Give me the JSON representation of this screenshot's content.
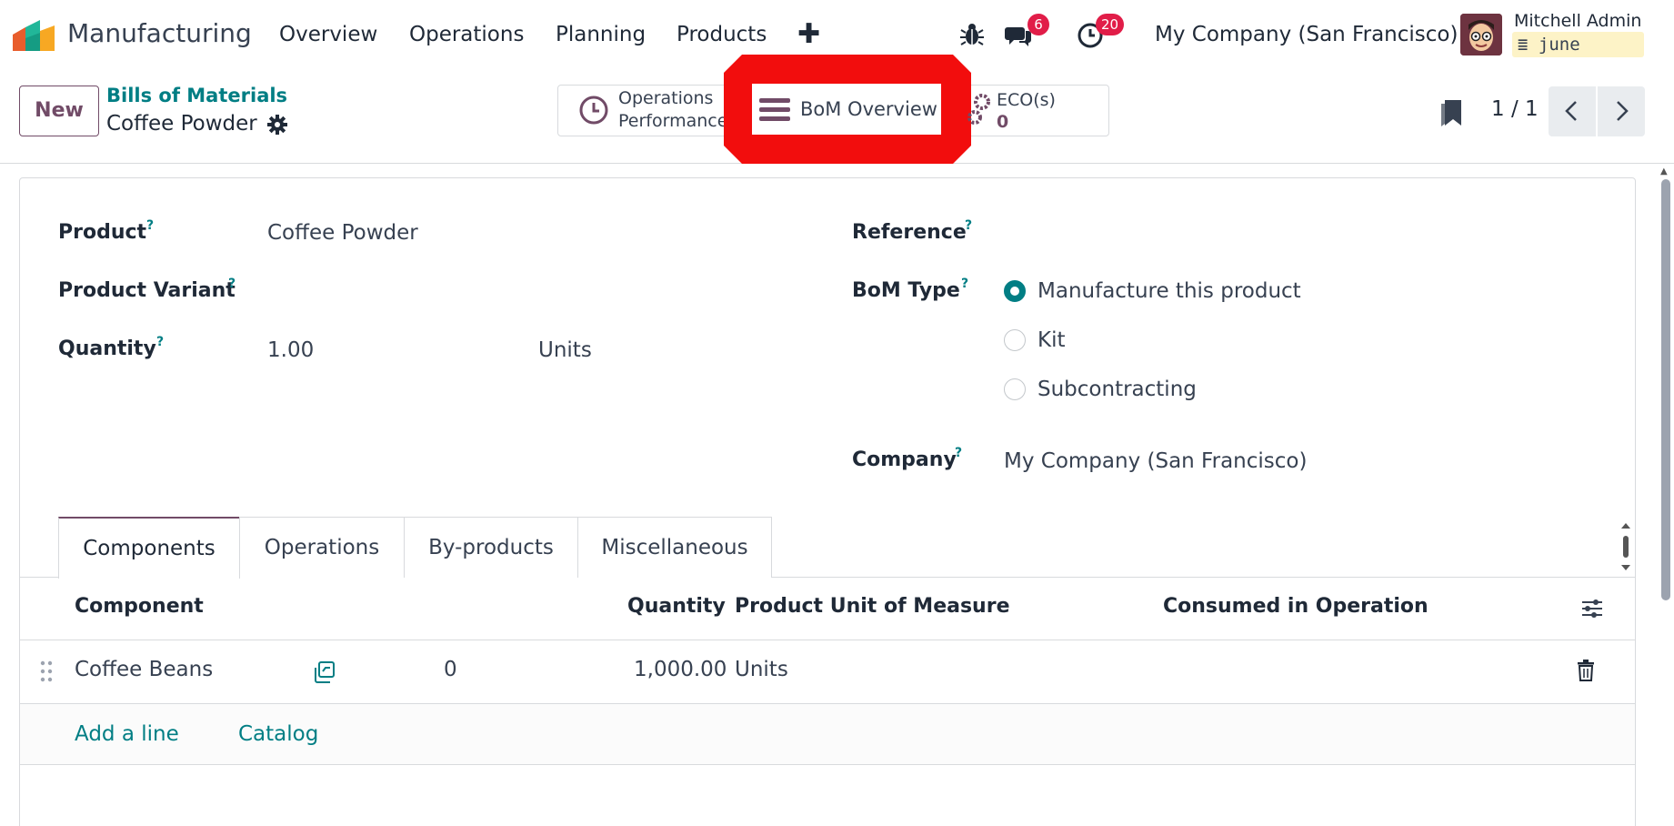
{
  "navbar": {
    "app_name": "Manufacturing",
    "menu": [
      "Overview",
      "Operations",
      "Planning",
      "Products"
    ],
    "plus": "✚",
    "messages_count": "6",
    "activities_count": "20",
    "company": "My Company (San Francisco)",
    "user_name": "Mitchell Admin",
    "db_name": "june",
    "icons": [
      "app-logo",
      "debug-bug-icon",
      "chat-icon",
      "clock-icon",
      "database-icon"
    ]
  },
  "control_panel": {
    "new_label": "New",
    "breadcrumb_parent": "Bills of Materials",
    "breadcrumb_current": "Coffee Powder",
    "smart_buttons": {
      "operations_line1": "Operations",
      "operations_line2": "Performance",
      "bom_overview": "BoM Overview",
      "eco_line1": "ECO(s)",
      "eco_count": "0"
    },
    "pager": "1 / 1",
    "highlight_color": "#f20d0d"
  },
  "form": {
    "product_label": "Product",
    "product_value": "Coffee Powder",
    "variant_label": "Product Variant",
    "quantity_label": "Quantity",
    "quantity_value": "1.00",
    "quantity_uom": "Units",
    "reference_label": "Reference",
    "bom_type_label": "BoM Type",
    "bom_type_options": [
      "Manufacture this product",
      "Kit",
      "Subcontracting"
    ],
    "bom_type_selected": "Manufacture this product",
    "company_label": "Company",
    "company_value": "My Company (San Francisco)",
    "help_mark": "?"
  },
  "tabs": [
    "Components",
    "Operations",
    "By-products",
    "Miscellaneous"
  ],
  "components": {
    "headers": [
      "Component",
      "Quantity",
      "Product Unit of Measure",
      "Consumed in Operation"
    ],
    "rows": [
      {
        "component": "Coffee Beans",
        "forecast": "0",
        "quantity": "1,000.00",
        "uom": "Units",
        "operation": ""
      }
    ],
    "add_line": "Add a line",
    "catalog": "Catalog"
  },
  "colors": {
    "brand": "#714b67",
    "accent": "#017e84",
    "badge": "#e11d48"
  }
}
